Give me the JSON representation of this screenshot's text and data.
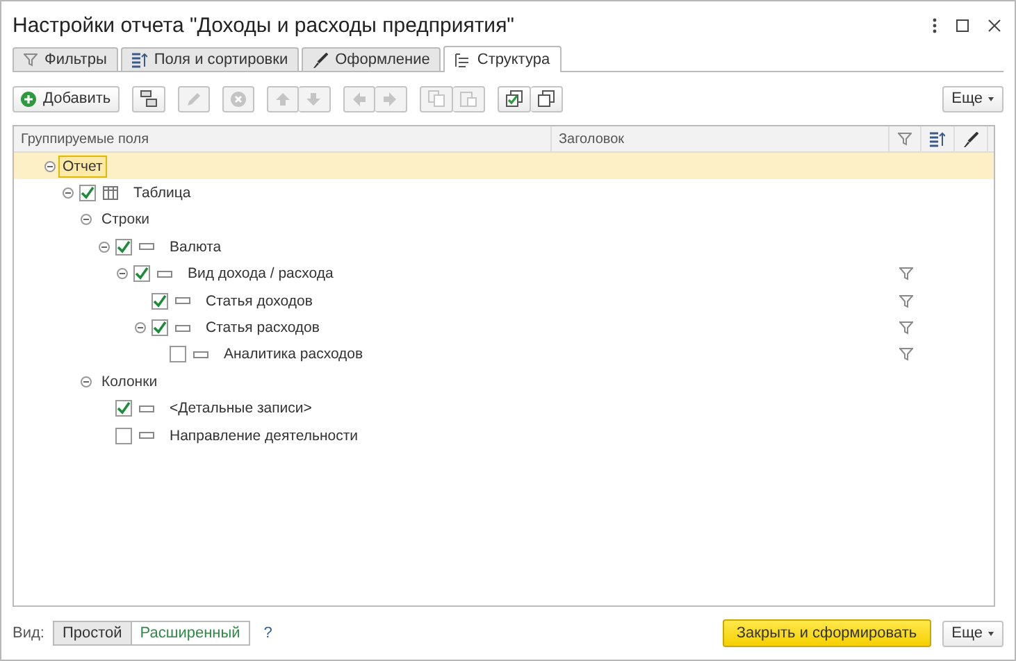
{
  "window": {
    "title": "Настройки отчета \"Доходы и расходы предприятия\""
  },
  "tabs": [
    {
      "kind": "filter",
      "label": "Фильтры",
      "selected": false
    },
    {
      "kind": "fields",
      "label": "Поля и сортировки",
      "selected": false
    },
    {
      "kind": "brush",
      "label": "Оформление",
      "selected": false
    },
    {
      "kind": "structure",
      "label": "Структура",
      "selected": true
    }
  ],
  "toolbar": {
    "groups": [
      {
        "buttons": [
          {
            "kind": "add",
            "label": "Добавить",
            "disabled": false
          }
        ]
      },
      {
        "buttons": [
          {
            "kind": "group",
            "disabled": false
          }
        ]
      },
      {
        "buttons": [
          {
            "kind": "edit",
            "disabled": true
          }
        ]
      },
      {
        "buttons": [
          {
            "kind": "delete",
            "disabled": true
          }
        ]
      },
      {
        "buttons": [
          {
            "kind": "up",
            "disabled": true
          },
          {
            "kind": "down",
            "disabled": true
          }
        ]
      },
      {
        "buttons": [
          {
            "kind": "left",
            "disabled": true
          },
          {
            "kind": "right",
            "disabled": true
          }
        ]
      },
      {
        "buttons": [
          {
            "kind": "copy",
            "disabled": true
          },
          {
            "kind": "paste",
            "disabled": true
          }
        ]
      },
      {
        "buttons": [
          {
            "kind": "check-all",
            "disabled": false
          },
          {
            "kind": "uncheck-all",
            "disabled": false
          }
        ]
      }
    ],
    "more": "Еще"
  },
  "table": {
    "columns": [
      {
        "kind": "text",
        "label": "Группируемые поля"
      },
      {
        "kind": "text",
        "label": "Заголовок"
      },
      {
        "kind": "filter"
      },
      {
        "kind": "sort"
      },
      {
        "kind": "brush"
      }
    ],
    "tree": [
      {
        "kind": "report",
        "label": "Отчет",
        "expanded": true,
        "selected": true,
        "filter": false,
        "children": [
          {
            "kind": "table",
            "label": "Таблица",
            "checked": true,
            "expanded": true,
            "selected": false,
            "filter": false,
            "children": [
              {
                "kind": "section",
                "label": "Строки",
                "expanded": true,
                "selected": false,
                "filter": false,
                "children": [
                  {
                    "kind": "field",
                    "label": "Валюта",
                    "checked": true,
                    "expanded": true,
                    "selected": false,
                    "filter": false,
                    "children": [
                      {
                        "kind": "field",
                        "label": "Вид дохода / расхода",
                        "checked": true,
                        "expanded": true,
                        "selected": false,
                        "filter": true,
                        "children": [
                          {
                            "kind": "field",
                            "label": "Статья доходов",
                            "checked": true,
                            "selected": false,
                            "filter": true
                          },
                          {
                            "kind": "field",
                            "label": "Статья расходов",
                            "checked": true,
                            "expanded": true,
                            "selected": false,
                            "filter": true,
                            "children": [
                              {
                                "kind": "field",
                                "label": "Аналитика расходов",
                                "checked": false,
                                "selected": false,
                                "filter": true
                              }
                            ]
                          }
                        ]
                      }
                    ]
                  }
                ]
              },
              {
                "kind": "section",
                "label": "Колонки",
                "expanded": true,
                "selected": false,
                "filter": false,
                "children": [
                  {
                    "kind": "field",
                    "label": "<Детальные записи>",
                    "checked": true,
                    "selected": false,
                    "filter": false
                  },
                  {
                    "kind": "field",
                    "label": "Направление деятельности",
                    "checked": false,
                    "selected": false,
                    "filter": false
                  }
                ]
              }
            ]
          }
        ]
      }
    ]
  },
  "footer": {
    "view_label": "Вид:",
    "modes": [
      {
        "label": "Простой",
        "selected": false
      },
      {
        "label": "Расширенный",
        "selected": true
      }
    ],
    "help": "?",
    "primary": "Закрыть и сформировать",
    "more": "Еще"
  }
}
